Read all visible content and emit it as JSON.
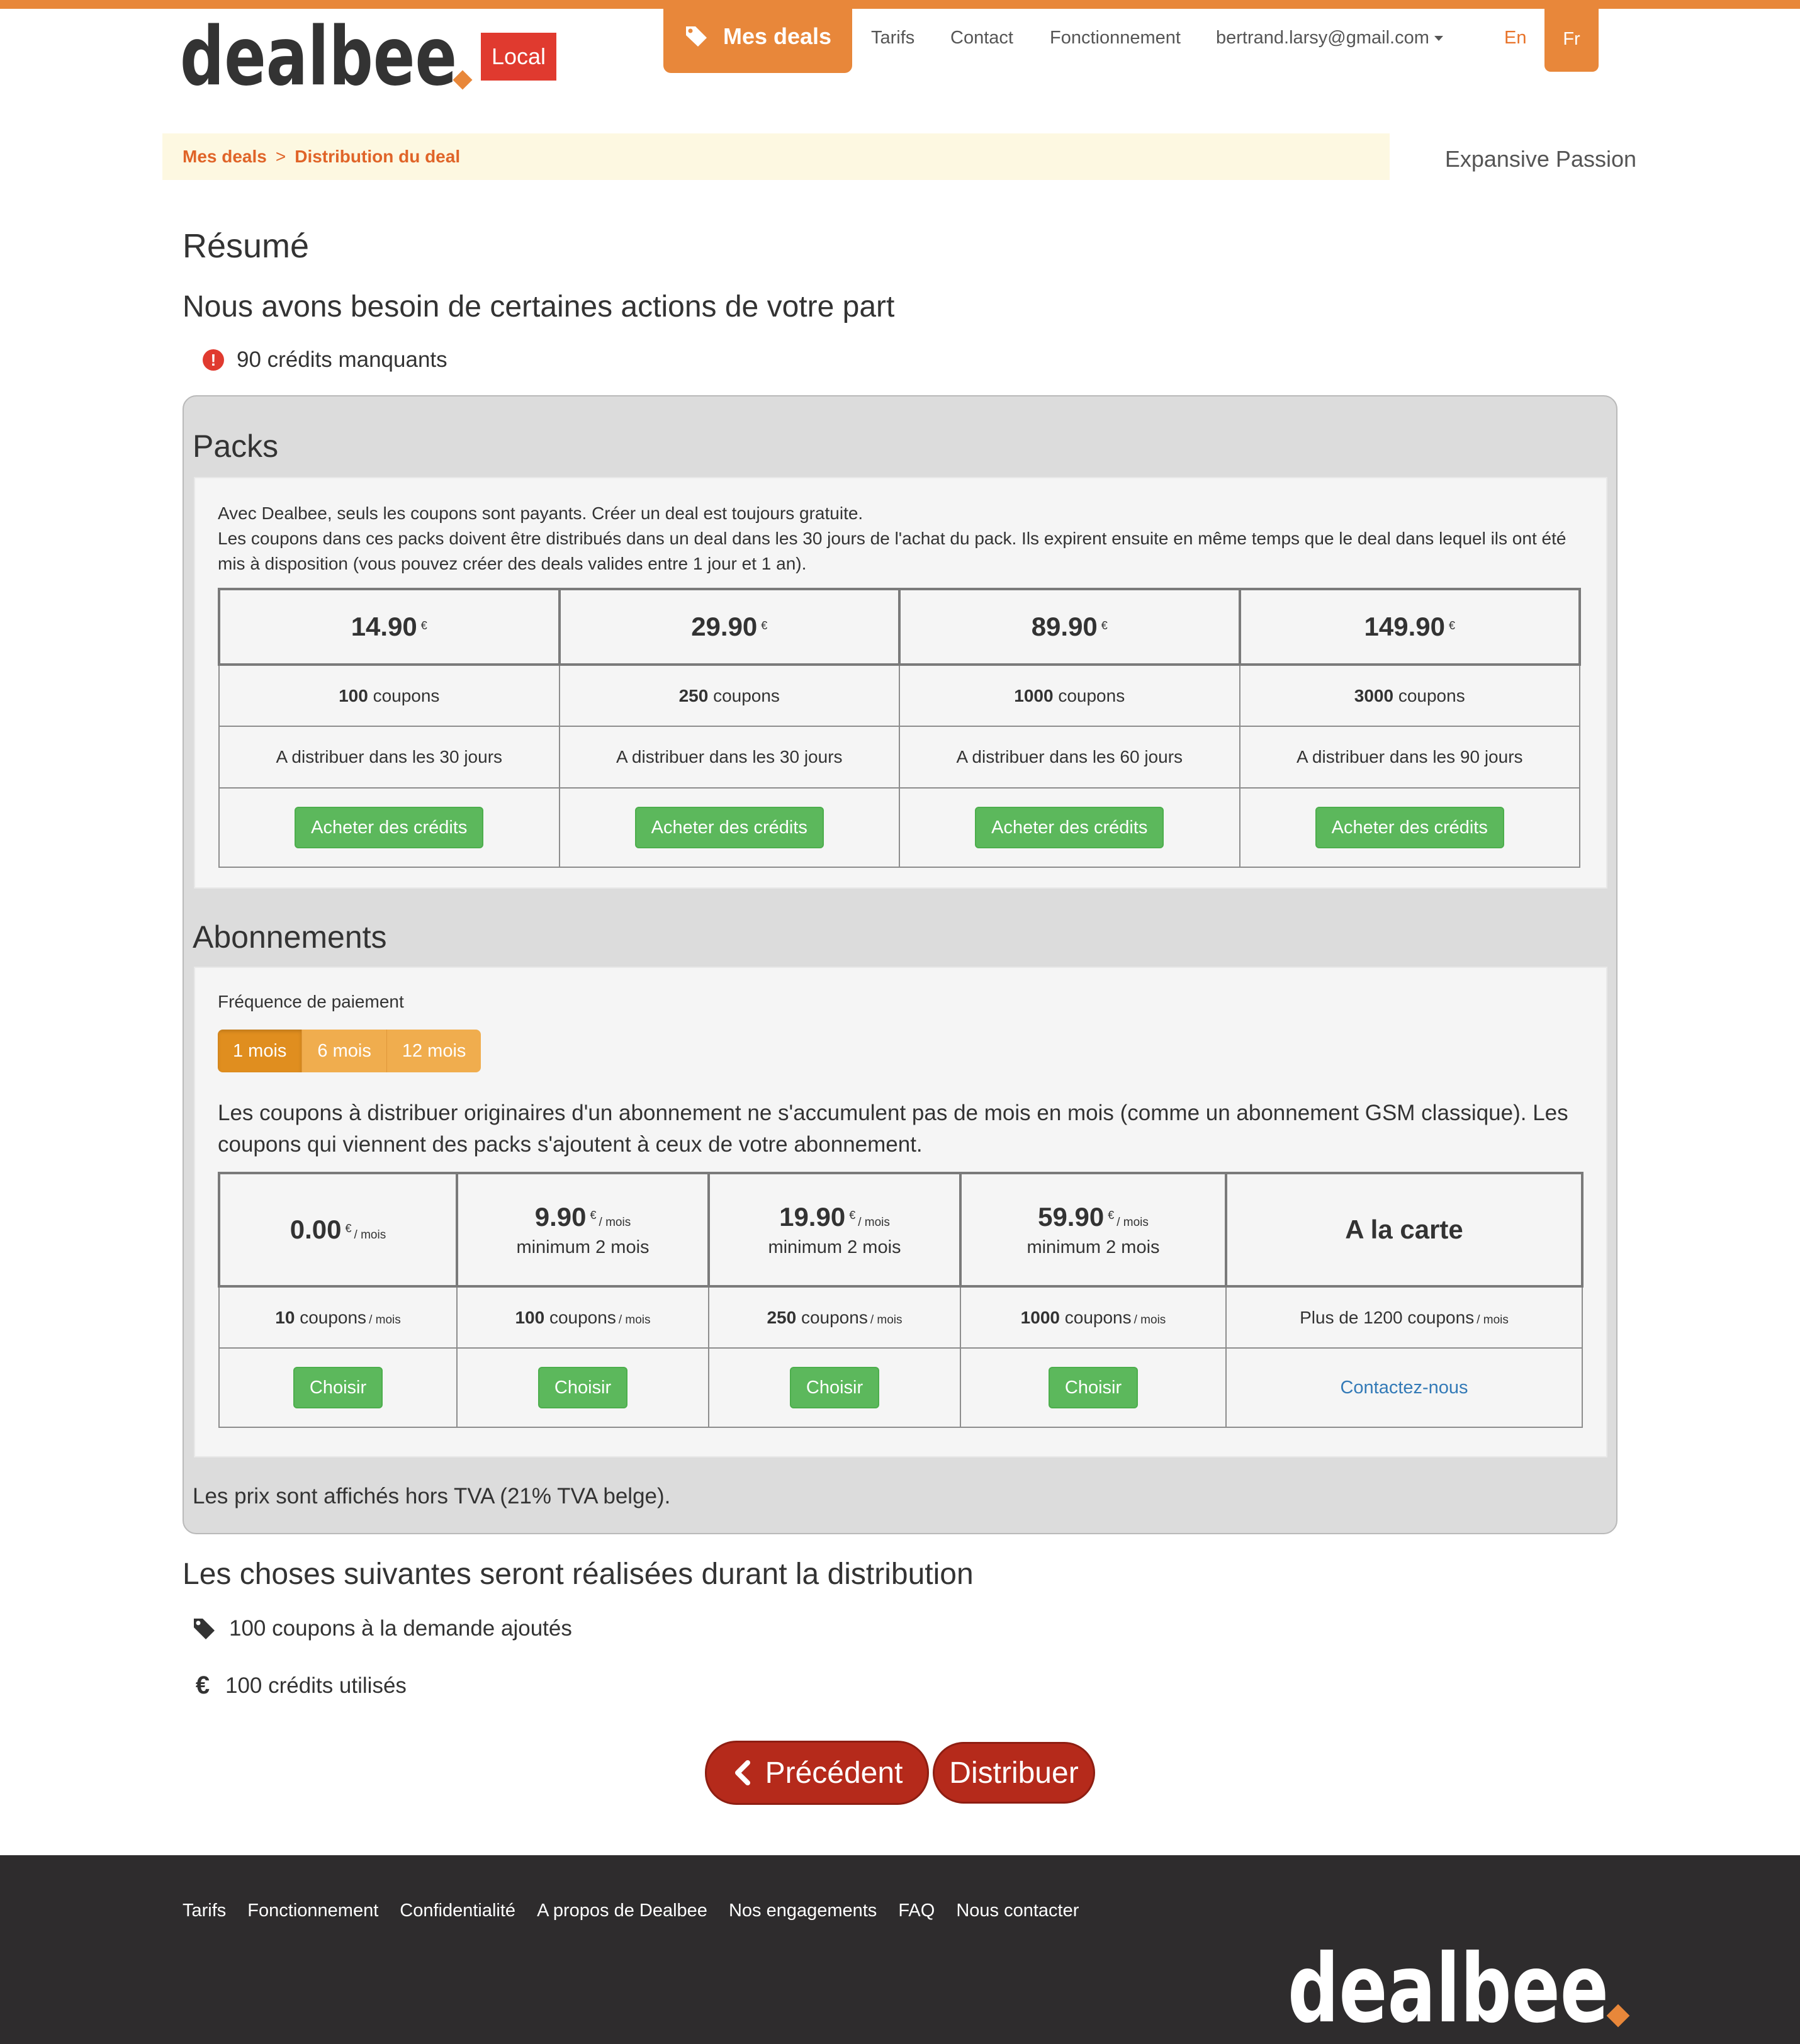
{
  "brand": {
    "logo_text": "dealbee",
    "badge": "Local",
    "accent": "#e8873a",
    "danger": "#b52a1b",
    "success": "#5cb85c"
  },
  "nav": {
    "my_deals": "Mes deals",
    "pricing": "Tarifs",
    "contact": "Contact",
    "how_it_works": "Fonctionnement",
    "user_email": "bertrand.larsy@gmail.com",
    "lang_en": "En",
    "lang_fr": "Fr",
    "icons": {
      "my_deals": "tags-icon",
      "user_menu": "caret-down-icon"
    }
  },
  "breadcrumb": {
    "items": [
      "Mes deals",
      "Distribution du deal"
    ],
    "separator": ">"
  },
  "account_name": "Expansive Passion",
  "summary": {
    "title": "Résumé",
    "actions_title": "Nous avons besoin de certaines actions de votre part",
    "missing_credits": "90 crédits manquants"
  },
  "packs": {
    "title": "Packs",
    "intro": [
      "Avec Dealbee, seuls les coupons sont payants. Créer un deal est toujours gratuite.",
      "Les coupons dans ces packs doivent être distribués dans un deal dans les 30 jours de l'achat du pack. Ils expirent ensuite en même temps que le deal dans lequel ils ont été mis à disposition (vous pouvez créer des deals valides entre 1 jour et 1 an)."
    ],
    "currency": "€",
    "coupons_word": "coupons",
    "button_label": "Acheter des crédits",
    "items": [
      {
        "price": "14.90",
        "coupons": "100",
        "validity": "A distribuer dans les 30 jours"
      },
      {
        "price": "29.90",
        "coupons": "250",
        "validity": "A distribuer dans les 30 jours"
      },
      {
        "price": "89.90",
        "coupons": "1000",
        "validity": "A distribuer dans les 60 jours"
      },
      {
        "price": "149.90",
        "coupons": "3000",
        "validity": "A distribuer dans les 90 jours"
      }
    ]
  },
  "subscriptions": {
    "title": "Abonnements",
    "frequency_label": "Fréquence de paiement",
    "frequencies": [
      "1 mois",
      "6 mois",
      "12 mois"
    ],
    "selected_frequency": "1 mois",
    "note": "Les coupons à distribuer originaires d'un abonnement ne s'accumulent pas de mois en mois (comme un abonnement GSM classique). Les coupons qui viennent des packs s'ajoutent à ceux de votre abonnement.",
    "currency": "€",
    "per_month": "/ mois",
    "coupons_word": "coupons",
    "choose_label": "Choisir",
    "plans": [
      {
        "price": "0.00",
        "minimum": "",
        "coupons": "10"
      },
      {
        "price": "9.90",
        "minimum": "minimum 2 mois",
        "coupons": "100"
      },
      {
        "price": "19.90",
        "minimum": "minimum 2 mois",
        "coupons": "250"
      },
      {
        "price": "59.90",
        "minimum": "minimum 2 mois",
        "coupons": "1000"
      }
    ],
    "custom": {
      "title": "A la carte",
      "coupons_text": "Plus de 1200 coupons",
      "contact_label": "Contactez-nous"
    }
  },
  "vat_note": "Les prix sont affichés hors TVA (21% TVA belge).",
  "distribution": {
    "title": "Les choses suivantes seront réalisées durant la distribution",
    "items": [
      {
        "icon": "tag-icon",
        "text": "100 coupons à la demande ajoutés"
      },
      {
        "icon": "euro-icon",
        "text": "100 crédits utilisés"
      }
    ]
  },
  "actions": {
    "previous": "Précédent",
    "distribute": "Distribuer"
  },
  "footer": {
    "links": [
      "Tarifs",
      "Fonctionnement",
      "Confidentialité",
      "A propos de Dealbee",
      "Nos engagements",
      "FAQ",
      "Nous contacter"
    ]
  }
}
